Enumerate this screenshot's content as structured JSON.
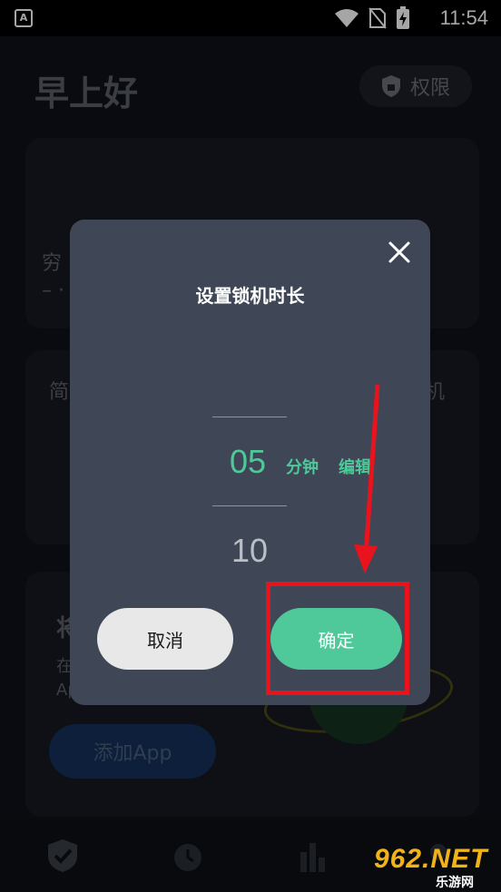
{
  "status_bar": {
    "app_icon_letter": "A",
    "time": "11:54"
  },
  "background": {
    "greeting": "早上好",
    "permission_button": "权限",
    "card1_line1": "穷",
    "card1_line2": "– ·",
    "card2_left": "简",
    "card2_right": "机",
    "card3_title": "将",
    "card3_sub1": "在",
    "card3_sub2": "Ap",
    "add_app_button": "添加App"
  },
  "dialog": {
    "title": "设置锁机时长",
    "picker": {
      "selected_value": "05",
      "unit": "分钟",
      "edit_label": "编辑",
      "next_value": "10"
    },
    "cancel_button": "取消",
    "confirm_button": "确定"
  },
  "colors": {
    "accent": "#4fc89a",
    "dialog_bg": "#3f4655",
    "annotation": "#e8131d",
    "watermark": "#f1b318"
  },
  "watermark": {
    "top": "962.NET",
    "bottom": "乐游网"
  }
}
